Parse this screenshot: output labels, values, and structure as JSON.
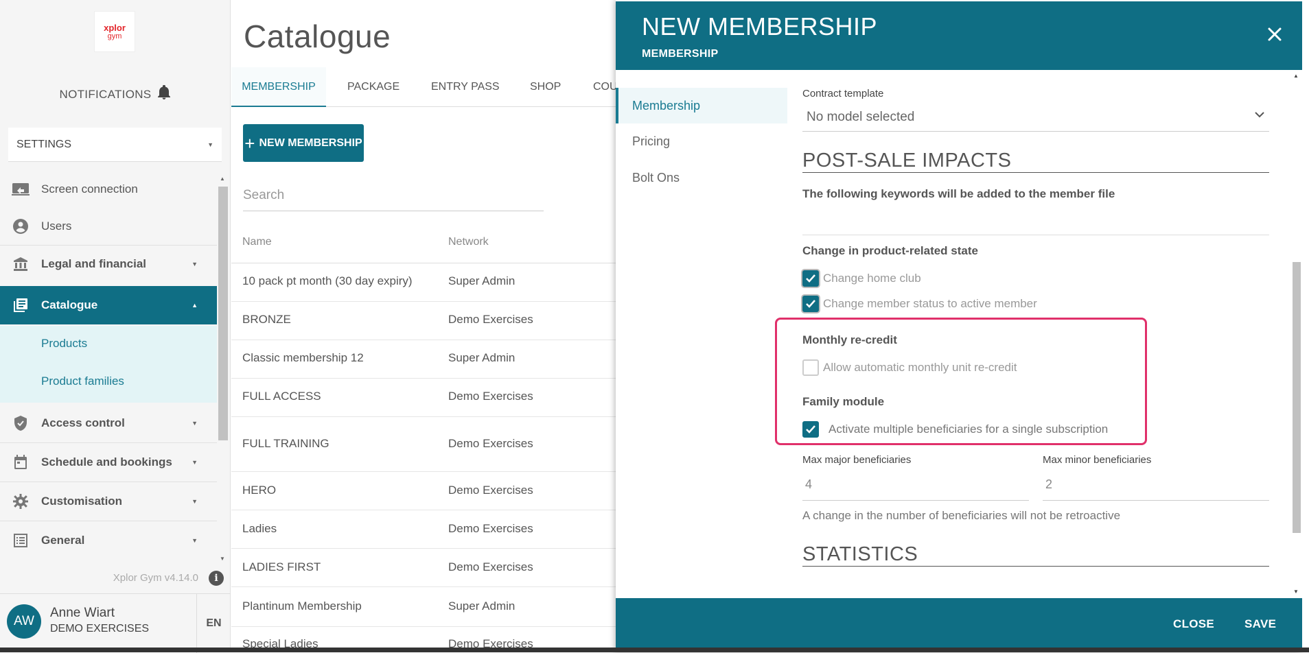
{
  "sidebar": {
    "logo": {
      "line1": "xplor",
      "line2": "gym"
    },
    "notifications_label": "NOTIFICATIONS",
    "settings_select": "SETTINGS",
    "menu": {
      "screen_connection": "Screen connection",
      "users": "Users",
      "legal": "Legal and financial",
      "catalogue": "Catalogue",
      "products": "Products",
      "product_families": "Product families",
      "access_control": "Access control",
      "schedule": "Schedule and bookings",
      "customisation": "Customisation",
      "general": "General"
    },
    "version": "Xplor Gym v4.14.0",
    "user": {
      "initials": "AW",
      "name": "Anne Wiart",
      "org": "DEMO EXERCISES"
    },
    "language": "EN"
  },
  "main": {
    "title": "Catalogue",
    "tabs": [
      "MEMBERSHIP",
      "PACKAGE",
      "ENTRY PASS",
      "SHOP",
      "COU"
    ],
    "new_button": "NEW MEMBERSHIP",
    "search_placeholder": "Search",
    "columns": [
      "Name",
      "Network"
    ],
    "rows": [
      {
        "name": "10 pack pt month (30 day expiry)",
        "network": "Super Admin"
      },
      {
        "name": "BRONZE",
        "network": "Demo Exercises"
      },
      {
        "name": "Classic membership 12",
        "network": "Super Admin"
      },
      {
        "name": "FULL ACCESS",
        "network": "Demo Exercises"
      },
      {
        "name": "FULL TRAINING",
        "network": "Demo Exercises"
      },
      {
        "name": "HERO",
        "network": "Demo Exercises"
      },
      {
        "name": "Ladies",
        "network": "Demo Exercises"
      },
      {
        "name": "LADIES FIRST",
        "network": "Demo Exercises"
      },
      {
        "name": "Plantinum Membership",
        "network": "Super Admin"
      },
      {
        "name": "Special Ladies",
        "network": "Demo Exercises"
      }
    ]
  },
  "dialog": {
    "title": "NEW MEMBERSHIP",
    "subtitle": "MEMBERSHIP",
    "nav": [
      "Membership",
      "Pricing",
      "Bolt Ons"
    ],
    "contract_template_label": "Contract template",
    "contract_template_value": "No model selected",
    "post_sale_heading": "POST-SALE IMPACTS",
    "keywords_label": "The following keywords will be added to the member file",
    "state_change_label": "Change in product-related state",
    "change_home_club": "Change home club",
    "change_member_status": "Change member status to active member",
    "monthly_recredit_label": "Monthly re-credit",
    "allow_recredit": "Allow automatic monthly unit re-credit",
    "family_module_label": "Family module",
    "activate_multiple": "Activate multiple beneficiaries for a single subscription",
    "max_major_label": "Max major beneficiaries",
    "max_major_value": "4",
    "max_minor_label": "Max minor beneficiaries",
    "max_minor_value": "2",
    "beneficiaries_note": "A change in the number of beneficiaries will not be retroactive",
    "statistics_heading": "STATISTICS",
    "close_button": "CLOSE",
    "save_button": "SAVE"
  },
  "colors": {
    "brand_teal": "#0f6e84",
    "highlight": "#e0306a",
    "logo_red": "#e3262b"
  }
}
